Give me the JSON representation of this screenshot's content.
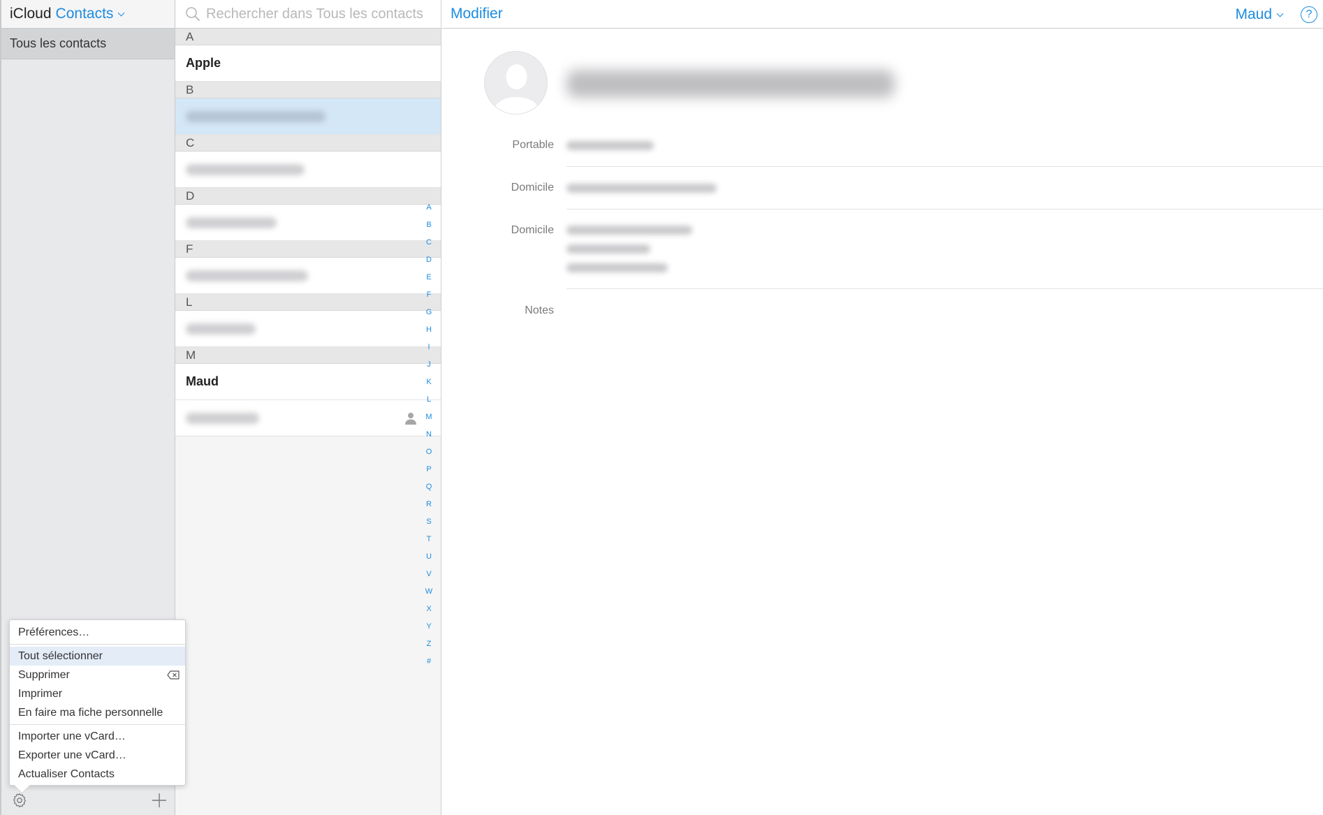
{
  "sidebar": {
    "brand": "iCloud",
    "app_name": "Contacts",
    "groups": [
      {
        "label": "Tous les contacts"
      }
    ]
  },
  "menu": {
    "items": [
      {
        "label": "Préférences…"
      },
      {
        "label": "Tout sélectionner"
      },
      {
        "label": "Supprimer"
      },
      {
        "label": "Imprimer"
      },
      {
        "label": "En faire ma fiche personnelle"
      },
      {
        "label": "Importer une vCard…"
      },
      {
        "label": "Exporter une vCard…"
      },
      {
        "label": "Actualiser Contacts"
      }
    ]
  },
  "search": {
    "placeholder": "Rechercher dans Tous les contacts"
  },
  "list": {
    "sections": [
      {
        "letter": "A",
        "rows": [
          {
            "name": "Apple"
          }
        ]
      },
      {
        "letter": "B"
      },
      {
        "letter": "C"
      },
      {
        "letter": "D"
      },
      {
        "letter": "F"
      },
      {
        "letter": "L"
      },
      {
        "letter": "M",
        "rows": [
          {
            "name": "Maud"
          }
        ]
      }
    ],
    "index": [
      "A",
      "B",
      "C",
      "D",
      "E",
      "F",
      "G",
      "H",
      "I",
      "J",
      "K",
      "L",
      "M",
      "N",
      "O",
      "P",
      "Q",
      "R",
      "S",
      "T",
      "U",
      "V",
      "W",
      "X",
      "Y",
      "Z",
      "#"
    ]
  },
  "detail": {
    "edit_label": "Modifier",
    "user_label": "Maud",
    "help_label": "?",
    "fields": [
      {
        "label": "Portable"
      },
      {
        "label": "Domicile"
      },
      {
        "label": "Domicile"
      },
      {
        "label": "Notes"
      }
    ]
  },
  "colors": {
    "accent": "#1c8ce0",
    "selection": "#d4e7f6",
    "sidebar": "#e8e9eb"
  }
}
